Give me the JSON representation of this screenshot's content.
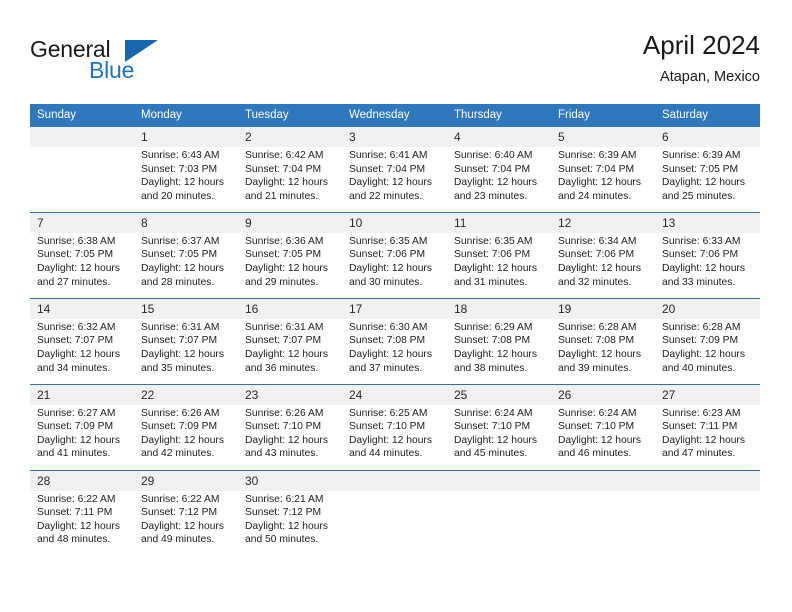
{
  "brand": {
    "name_part1": "General",
    "name_part2": "Blue",
    "triangle_color": "#1766ab",
    "blue_color": "#1c74bc"
  },
  "header": {
    "title": "April 2024",
    "subtitle": "Atapan, Mexico"
  },
  "theme": {
    "header_bg": "#2f78bd",
    "daynum_bg": "#f1f1f1",
    "separator": "#2f6fad"
  },
  "weekdays": [
    "Sunday",
    "Monday",
    "Tuesday",
    "Wednesday",
    "Thursday",
    "Friday",
    "Saturday"
  ],
  "weeks": [
    {
      "days": [
        {
          "date": "",
          "sunrise": "",
          "sunset": "",
          "daylight_l1": "",
          "daylight_l2": ""
        },
        {
          "date": "1",
          "sunrise": "Sunrise: 6:43 AM",
          "sunset": "Sunset: 7:03 PM",
          "daylight_l1": "Daylight: 12 hours",
          "daylight_l2": "and 20 minutes."
        },
        {
          "date": "2",
          "sunrise": "Sunrise: 6:42 AM",
          "sunset": "Sunset: 7:04 PM",
          "daylight_l1": "Daylight: 12 hours",
          "daylight_l2": "and 21 minutes."
        },
        {
          "date": "3",
          "sunrise": "Sunrise: 6:41 AM",
          "sunset": "Sunset: 7:04 PM",
          "daylight_l1": "Daylight: 12 hours",
          "daylight_l2": "and 22 minutes."
        },
        {
          "date": "4",
          "sunrise": "Sunrise: 6:40 AM",
          "sunset": "Sunset: 7:04 PM",
          "daylight_l1": "Daylight: 12 hours",
          "daylight_l2": "and 23 minutes."
        },
        {
          "date": "5",
          "sunrise": "Sunrise: 6:39 AM",
          "sunset": "Sunset: 7:04 PM",
          "daylight_l1": "Daylight: 12 hours",
          "daylight_l2": "and 24 minutes."
        },
        {
          "date": "6",
          "sunrise": "Sunrise: 6:39 AM",
          "sunset": "Sunset: 7:05 PM",
          "daylight_l1": "Daylight: 12 hours",
          "daylight_l2": "and 25 minutes."
        }
      ]
    },
    {
      "days": [
        {
          "date": "7",
          "sunrise": "Sunrise: 6:38 AM",
          "sunset": "Sunset: 7:05 PM",
          "daylight_l1": "Daylight: 12 hours",
          "daylight_l2": "and 27 minutes."
        },
        {
          "date": "8",
          "sunrise": "Sunrise: 6:37 AM",
          "sunset": "Sunset: 7:05 PM",
          "daylight_l1": "Daylight: 12 hours",
          "daylight_l2": "and 28 minutes."
        },
        {
          "date": "9",
          "sunrise": "Sunrise: 6:36 AM",
          "sunset": "Sunset: 7:05 PM",
          "daylight_l1": "Daylight: 12 hours",
          "daylight_l2": "and 29 minutes."
        },
        {
          "date": "10",
          "sunrise": "Sunrise: 6:35 AM",
          "sunset": "Sunset: 7:06 PM",
          "daylight_l1": "Daylight: 12 hours",
          "daylight_l2": "and 30 minutes."
        },
        {
          "date": "11",
          "sunrise": "Sunrise: 6:35 AM",
          "sunset": "Sunset: 7:06 PM",
          "daylight_l1": "Daylight: 12 hours",
          "daylight_l2": "and 31 minutes."
        },
        {
          "date": "12",
          "sunrise": "Sunrise: 6:34 AM",
          "sunset": "Sunset: 7:06 PM",
          "daylight_l1": "Daylight: 12 hours",
          "daylight_l2": "and 32 minutes."
        },
        {
          "date": "13",
          "sunrise": "Sunrise: 6:33 AM",
          "sunset": "Sunset: 7:06 PM",
          "daylight_l1": "Daylight: 12 hours",
          "daylight_l2": "and 33 minutes."
        }
      ]
    },
    {
      "days": [
        {
          "date": "14",
          "sunrise": "Sunrise: 6:32 AM",
          "sunset": "Sunset: 7:07 PM",
          "daylight_l1": "Daylight: 12 hours",
          "daylight_l2": "and 34 minutes."
        },
        {
          "date": "15",
          "sunrise": "Sunrise: 6:31 AM",
          "sunset": "Sunset: 7:07 PM",
          "daylight_l1": "Daylight: 12 hours",
          "daylight_l2": "and 35 minutes."
        },
        {
          "date": "16",
          "sunrise": "Sunrise: 6:31 AM",
          "sunset": "Sunset: 7:07 PM",
          "daylight_l1": "Daylight: 12 hours",
          "daylight_l2": "and 36 minutes."
        },
        {
          "date": "17",
          "sunrise": "Sunrise: 6:30 AM",
          "sunset": "Sunset: 7:08 PM",
          "daylight_l1": "Daylight: 12 hours",
          "daylight_l2": "and 37 minutes."
        },
        {
          "date": "18",
          "sunrise": "Sunrise: 6:29 AM",
          "sunset": "Sunset: 7:08 PM",
          "daylight_l1": "Daylight: 12 hours",
          "daylight_l2": "and 38 minutes."
        },
        {
          "date": "19",
          "sunrise": "Sunrise: 6:28 AM",
          "sunset": "Sunset: 7:08 PM",
          "daylight_l1": "Daylight: 12 hours",
          "daylight_l2": "and 39 minutes."
        },
        {
          "date": "20",
          "sunrise": "Sunrise: 6:28 AM",
          "sunset": "Sunset: 7:09 PM",
          "daylight_l1": "Daylight: 12 hours",
          "daylight_l2": "and 40 minutes."
        }
      ]
    },
    {
      "days": [
        {
          "date": "21",
          "sunrise": "Sunrise: 6:27 AM",
          "sunset": "Sunset: 7:09 PM",
          "daylight_l1": "Daylight: 12 hours",
          "daylight_l2": "and 41 minutes."
        },
        {
          "date": "22",
          "sunrise": "Sunrise: 6:26 AM",
          "sunset": "Sunset: 7:09 PM",
          "daylight_l1": "Daylight: 12 hours",
          "daylight_l2": "and 42 minutes."
        },
        {
          "date": "23",
          "sunrise": "Sunrise: 6:26 AM",
          "sunset": "Sunset: 7:10 PM",
          "daylight_l1": "Daylight: 12 hours",
          "daylight_l2": "and 43 minutes."
        },
        {
          "date": "24",
          "sunrise": "Sunrise: 6:25 AM",
          "sunset": "Sunset: 7:10 PM",
          "daylight_l1": "Daylight: 12 hours",
          "daylight_l2": "and 44 minutes."
        },
        {
          "date": "25",
          "sunrise": "Sunrise: 6:24 AM",
          "sunset": "Sunset: 7:10 PM",
          "daylight_l1": "Daylight: 12 hours",
          "daylight_l2": "and 45 minutes."
        },
        {
          "date": "26",
          "sunrise": "Sunrise: 6:24 AM",
          "sunset": "Sunset: 7:10 PM",
          "daylight_l1": "Daylight: 12 hours",
          "daylight_l2": "and 46 minutes."
        },
        {
          "date": "27",
          "sunrise": "Sunrise: 6:23 AM",
          "sunset": "Sunset: 7:11 PM",
          "daylight_l1": "Daylight: 12 hours",
          "daylight_l2": "and 47 minutes."
        }
      ]
    },
    {
      "days": [
        {
          "date": "28",
          "sunrise": "Sunrise: 6:22 AM",
          "sunset": "Sunset: 7:11 PM",
          "daylight_l1": "Daylight: 12 hours",
          "daylight_l2": "and 48 minutes."
        },
        {
          "date": "29",
          "sunrise": "Sunrise: 6:22 AM",
          "sunset": "Sunset: 7:12 PM",
          "daylight_l1": "Daylight: 12 hours",
          "daylight_l2": "and 49 minutes."
        },
        {
          "date": "30",
          "sunrise": "Sunrise: 6:21 AM",
          "sunset": "Sunset: 7:12 PM",
          "daylight_l1": "Daylight: 12 hours",
          "daylight_l2": "and 50 minutes."
        },
        {
          "date": "",
          "sunrise": "",
          "sunset": "",
          "daylight_l1": "",
          "daylight_l2": ""
        },
        {
          "date": "",
          "sunrise": "",
          "sunset": "",
          "daylight_l1": "",
          "daylight_l2": ""
        },
        {
          "date": "",
          "sunrise": "",
          "sunset": "",
          "daylight_l1": "",
          "daylight_l2": ""
        },
        {
          "date": "",
          "sunrise": "",
          "sunset": "",
          "daylight_l1": "",
          "daylight_l2": ""
        }
      ]
    }
  ]
}
